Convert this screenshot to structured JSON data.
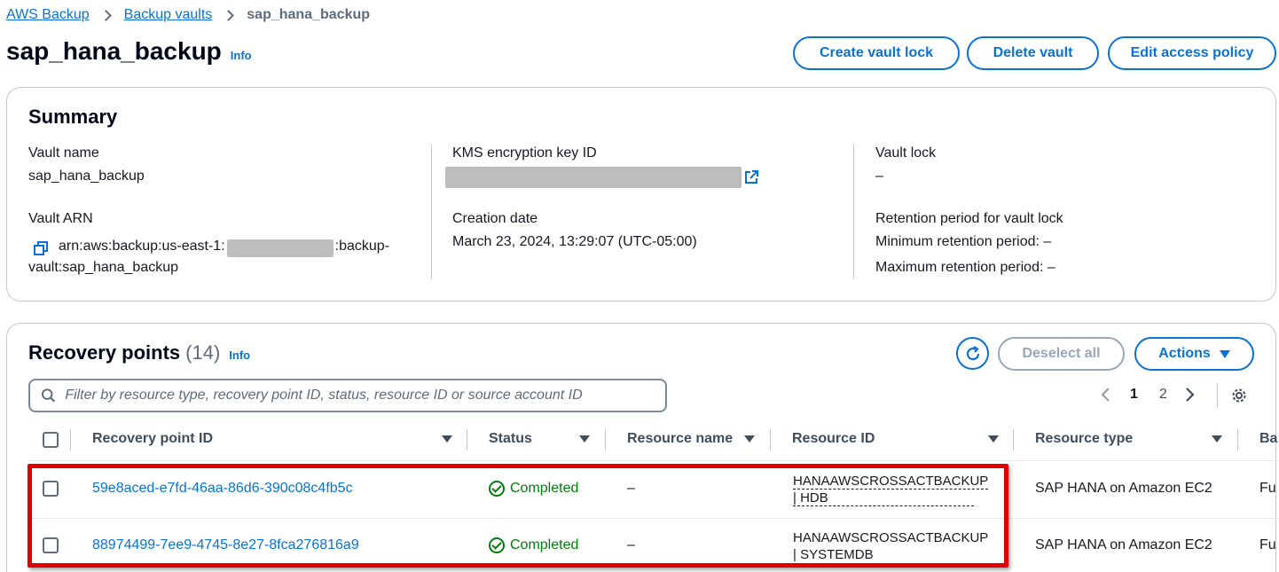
{
  "breadcrumb": {
    "items": [
      "AWS Backup",
      "Backup vaults"
    ],
    "current": "sap_hana_backup"
  },
  "header": {
    "title": "sap_hana_backup",
    "info": "Info",
    "buttons": {
      "create_lock": "Create vault lock",
      "delete": "Delete vault",
      "edit_policy": "Edit access policy"
    }
  },
  "summary": {
    "title": "Summary",
    "vault_name_label": "Vault name",
    "vault_name": "sap_hana_backup",
    "vault_arn_label": "Vault ARN",
    "vault_arn_prefix": "arn:aws:backup:us-east-1:",
    "vault_arn_suffix": ":backup-",
    "vault_arn_line2": "vault:sap_hana_backup",
    "kms_label": "KMS encryption key ID",
    "creation_label": "Creation date",
    "creation_date": "March 23, 2024, 13:29:07 (UTC-05:00)",
    "vault_lock_label": "Vault lock",
    "vault_lock_value": "–",
    "retention_label": "Retention period for vault lock",
    "min_retention": "Minimum retention period: –",
    "max_retention": "Maximum retention period: –"
  },
  "recovery": {
    "title": "Recovery points",
    "count": "(14)",
    "info": "Info",
    "deselect": "Deselect all",
    "actions": "Actions",
    "filter_placeholder": "Filter by resource type, recovery point ID, status, resource ID or source account ID",
    "pages": [
      "1",
      "2"
    ],
    "columns": {
      "id": "Recovery point ID",
      "status": "Status",
      "resource_name": "Resource name",
      "resource_id": "Resource ID",
      "resource_type": "Resource type",
      "extra": "Ba"
    },
    "rows": [
      {
        "id": "59e8aced-e7fd-46aa-86d6-390c08c4fb5c",
        "status": "Completed",
        "resource_name": "–",
        "resource_id_line1": "HANAAWSCROSSACTBACKUP",
        "resource_id_line2": "| HDB",
        "resource_type": "SAP HANA on Amazon EC2",
        "extra": "Fu"
      },
      {
        "id": "88974499-7ee9-4745-8e27-8fca276816a9",
        "status": "Completed",
        "resource_name": "–",
        "resource_id_line1": "HANAAWSCROSSACTBACKUP",
        "resource_id_line2": "| SYSTEMDB",
        "resource_type": "SAP HANA on Amazon EC2",
        "extra": "Fu"
      }
    ]
  },
  "colors": {
    "link": "#0972d3",
    "success": "#037f0c",
    "highlight": "#e00000"
  }
}
